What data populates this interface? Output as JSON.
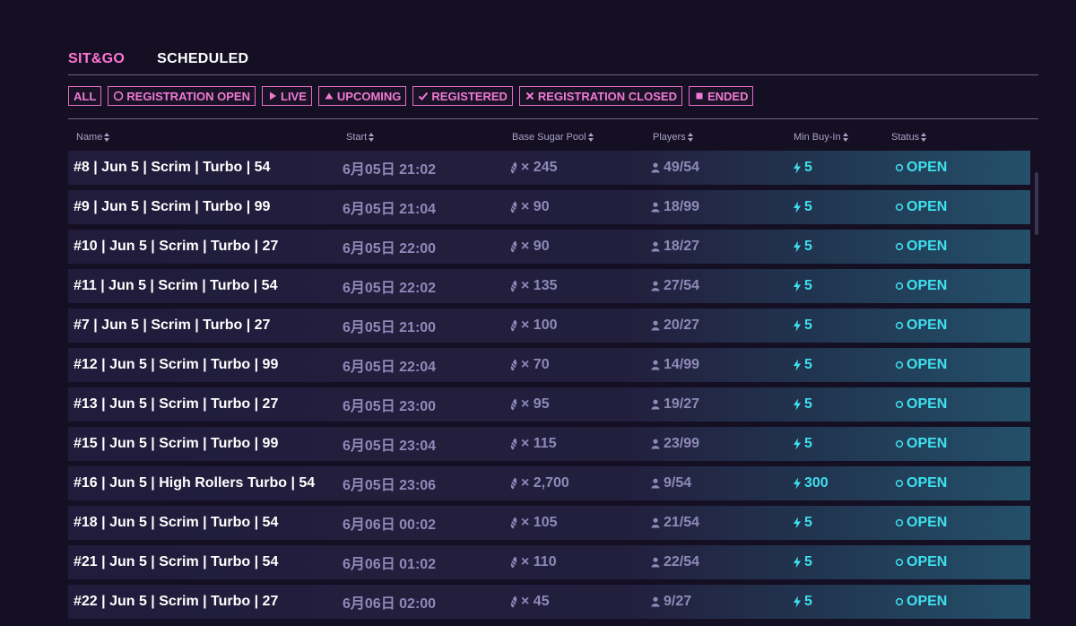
{
  "tabs": [
    {
      "label": "SIT&GO",
      "active": true
    },
    {
      "label": "SCHEDULED",
      "active": false
    }
  ],
  "filters": [
    {
      "label": "ALL",
      "icon": "none"
    },
    {
      "label": "REGISTRATION OPEN",
      "icon": "circle-icon"
    },
    {
      "label": "LIVE",
      "icon": "play-icon"
    },
    {
      "label": "UPCOMING",
      "icon": "triangle-up-icon"
    },
    {
      "label": "REGISTERED",
      "icon": "check-icon"
    },
    {
      "label": "REGISTRATION CLOSED",
      "icon": "x-icon"
    },
    {
      "label": "ENDED",
      "icon": "square-icon"
    }
  ],
  "columns": {
    "name": "Name",
    "start": "Start",
    "pool": "Base Sugar Pool",
    "players": "Players",
    "buyin": "Min Buy-In",
    "status": "Status"
  },
  "rows": [
    {
      "name": "#8 | Jun 5 | Scrim | Turbo | 54",
      "start": "6月05日 21:02",
      "pool": "× 245",
      "players": "49/54",
      "buyin": "5",
      "status": "OPEN"
    },
    {
      "name": "#9 | Jun 5 | Scrim | Turbo | 99",
      "start": "6月05日 21:04",
      "pool": "× 90",
      "players": "18/99",
      "buyin": "5",
      "status": "OPEN"
    },
    {
      "name": "#10 | Jun 5 | Scrim | Turbo | 27",
      "start": "6月05日 22:00",
      "pool": "× 90",
      "players": "18/27",
      "buyin": "5",
      "status": "OPEN"
    },
    {
      "name": "#11 | Jun 5 | Scrim | Turbo | 54",
      "start": "6月05日 22:02",
      "pool": "× 135",
      "players": "27/54",
      "buyin": "5",
      "status": "OPEN"
    },
    {
      "name": "#7 | Jun 5 | Scrim | Turbo | 27",
      "start": "6月05日 21:00",
      "pool": "× 100",
      "players": "20/27",
      "buyin": "5",
      "status": "OPEN"
    },
    {
      "name": "#12 | Jun 5 | Scrim | Turbo | 99",
      "start": "6月05日 22:04",
      "pool": "× 70",
      "players": "14/99",
      "buyin": "5",
      "status": "OPEN"
    },
    {
      "name": "#13 | Jun 5 | Scrim | Turbo | 27",
      "start": "6月05日 23:00",
      "pool": "× 95",
      "players": "19/27",
      "buyin": "5",
      "status": "OPEN"
    },
    {
      "name": "#15 | Jun 5 | Scrim | Turbo | 99",
      "start": "6月05日 23:04",
      "pool": "× 115",
      "players": "23/99",
      "buyin": "5",
      "status": "OPEN"
    },
    {
      "name": "#16 | Jun 5 | High Rollers Turbo | 54",
      "start": "6月05日 23:06",
      "pool": "× 2,700",
      "players": "9/54",
      "buyin": "300",
      "status": "OPEN"
    },
    {
      "name": "#18 | Jun 5 | Scrim | Turbo | 54",
      "start": "6月06日 00:02",
      "pool": "× 105",
      "players": "21/54",
      "buyin": "5",
      "status": "OPEN"
    },
    {
      "name": "#21 | Jun 5 | Scrim | Turbo | 54",
      "start": "6月06日 01:02",
      "pool": "× 110",
      "players": "22/54",
      "buyin": "5",
      "status": "OPEN"
    },
    {
      "name": "#22 | Jun 5 | Scrim | Turbo | 27",
      "start": "6月06日 02:00",
      "pool": "× 45",
      "players": "9/27",
      "buyin": "5",
      "status": "OPEN"
    }
  ],
  "colors": {
    "accent": "#ff74d4",
    "teal": "#3fe0ec",
    "muted": "#8f89b8",
    "background": "#150f24"
  }
}
